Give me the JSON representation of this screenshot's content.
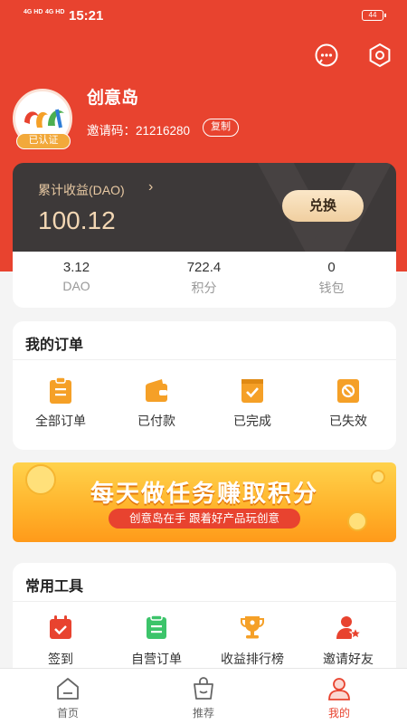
{
  "status_bar": {
    "time": "15:21",
    "signal1": "4G HD",
    "signal2": "4G HD",
    "battery": "44"
  },
  "profile": {
    "name": "创意岛",
    "invite_label": "邀请码：",
    "invite_code": "21216280",
    "copy_label": "复制",
    "verified_label": "已认证"
  },
  "earnings": {
    "label": "累计收益(DAO)",
    "value": "100.12",
    "exchange_label": "兑换"
  },
  "stats": [
    {
      "value": "3.12",
      "label": "DAO"
    },
    {
      "value": "722.4",
      "label": "积分"
    },
    {
      "value": "0",
      "label": "钱包"
    }
  ],
  "orders": {
    "title": "我的订单",
    "items": [
      {
        "label": "全部订单",
        "icon": "clipboard-list-icon"
      },
      {
        "label": "已付款",
        "icon": "wallet-icon"
      },
      {
        "label": "已完成",
        "icon": "check-box-icon"
      },
      {
        "label": "已失效",
        "icon": "invalid-icon"
      }
    ]
  },
  "banner": {
    "title": "每天做任务赚取积分",
    "subtitle": "创意岛在手 跟着好产品玩创意"
  },
  "tools": {
    "title": "常用工具",
    "items": [
      {
        "label": "签到",
        "icon": "calendar-check-icon"
      },
      {
        "label": "自营订单",
        "icon": "document-icon"
      },
      {
        "label": "收益排行榜",
        "icon": "trophy-icon"
      },
      {
        "label": "邀请好友",
        "icon": "user-star-icon"
      }
    ]
  },
  "tabbar": [
    {
      "label": "首页",
      "icon": "home-icon"
    },
    {
      "label": "推荐",
      "icon": "shopping-bag-icon"
    },
    {
      "label": "我的",
      "icon": "user-icon"
    }
  ],
  "colors": {
    "primary": "#e8432f",
    "orange": "#f5a027",
    "dark_card": "#3d3939",
    "gold": "#f3d7b4"
  }
}
